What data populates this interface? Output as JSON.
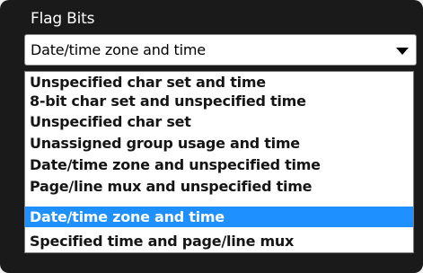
{
  "field": {
    "label": "Flag Bits",
    "selected_value": "Date/time zone and time"
  },
  "dropdown": {
    "options": [
      {
        "label": "Unspecified char set and time",
        "selected": false
      },
      {
        "label": "8-bit char set and unspecified time",
        "selected": false
      },
      {
        "label": "Unspecified char set",
        "selected": false
      },
      {
        "label": "Unassigned group usage and time",
        "selected": false
      },
      {
        "label": "Date/time zone and unspecified time",
        "selected": false
      },
      {
        "label": "Page/line mux and unspecified time",
        "selected": false
      },
      {
        "label": "Date/time zone and time",
        "selected": true
      },
      {
        "label": "Specified time and page/line mux",
        "selected": false
      }
    ]
  },
  "colors": {
    "panel_background": "#1a1a1a",
    "highlight": "#1e90ff",
    "option_text": "#151515"
  },
  "icons": {
    "dropdown_arrow": "chevron-down-icon"
  }
}
